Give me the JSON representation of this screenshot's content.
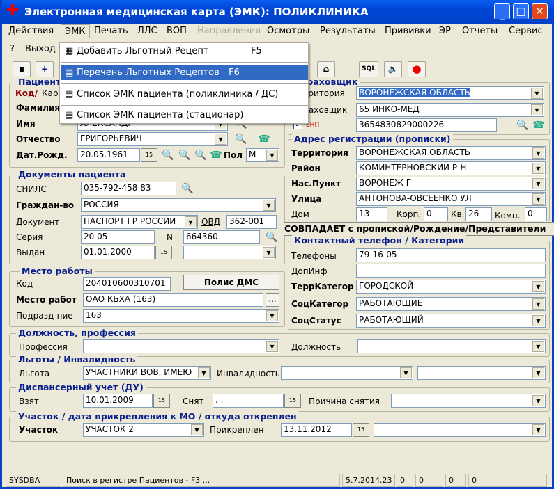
{
  "window": {
    "title": "Электронная медицинская карта (ЭМК): ПОЛИКЛИНИКА"
  },
  "menubar": [
    "Действия",
    "ЭМК",
    "Печать",
    "ЛЛС",
    "ВОП",
    "Направления",
    "Осмотры",
    "Результаты",
    "Прививки",
    "ЭР",
    "Отчеты",
    "Сервис"
  ],
  "menubar2": [
    "?",
    "Выход"
  ],
  "emk_menu": [
    {
      "label": "Добавить Льготный Рецепт",
      "shortcut": "F5"
    },
    {
      "label": "Перечень Льготных Рецептов",
      "shortcut": "F6",
      "highlighted": true
    },
    {
      "label": "Список ЭМК пациента (поликлиника / ДС)",
      "shortcut": ""
    },
    {
      "label": "Список ЭМК пациента (стационар)",
      "shortcut": ""
    }
  ],
  "toolbar": {
    "sql": "SQL"
  },
  "patient": {
    "header": "Пациент",
    "kod_label": "Код/",
    "kar_label": "Кар",
    "surname_label": "Фамилия",
    "name_label": "Имя",
    "name": "АЛЕКСАНДР",
    "patronymic_label": "Отчество",
    "patronymic": "ГРИГОРЬЕВИЧ",
    "dob_label": "Дат.Рожд.",
    "dob": "20.05.1961",
    "sex_label": "Пол",
    "sex": "М"
  },
  "documents": {
    "header": "Документы пациента",
    "snils_label": "СНИЛС",
    "snils": "035-792-458 83",
    "citizenship_label": "Граждан-во",
    "citizenship": "РОССИЯ",
    "doc_label": "Документ",
    "doc": "ПАСПОРТ ГР РОССИИ",
    "ovd_label": "ОВД",
    "ovd": "362-001",
    "series_label": "Серия",
    "series": "20 05",
    "n_label": "N",
    "number": "664360",
    "issued_label": "Выдан",
    "issued": "01.01.2000"
  },
  "work": {
    "header": "Место работы",
    "code_label": "Код",
    "code": "204010600310701",
    "dms_button": "Полис ДМС",
    "place_label": "Место работ",
    "place": "ОАО КБХА (163)",
    "more": "...",
    "dept_label": "Подразд-ние",
    "dept": "163"
  },
  "insurer": {
    "header": "Страховщик",
    "territory_label": "Территория",
    "territory": "ВОРОНЕЖСКАЯ ОБЛАСТЬ",
    "insurer_label": "Страховщик",
    "insurer": "65 ИНКО-МЕД",
    "enp_label": "ЕНП",
    "enp": "3654830829000226",
    "enp_checked": true
  },
  "address": {
    "header": "Адрес регистрации (прописки)",
    "territory_label": "Территория",
    "territory": "ВОРОНЕЖСКАЯ ОБЛАСТЬ",
    "district_label": "Район",
    "district": "КОМИНТЕРНОВСКИЙ Р-Н",
    "city_label": "Нас.Пункт",
    "city": "ВОРОНЕЖ Г",
    "street_label": "Улица",
    "street": "АНТОНОВА-ОВСЕЕНКО УЛ",
    "house_label": "Дом",
    "house": "13",
    "korp_label": "Корп.",
    "korp": "0",
    "kv_label": "Кв.",
    "kv": "26",
    "komn_label": "Комн.",
    "komn": "0"
  },
  "banner": "СОВПАДАЕТ с пропиской/Рождение/Представители",
  "contact": {
    "header": "Контактный телефон  / Категории",
    "phones_label": "Телефоны",
    "phones": "79-16-05",
    "dopinf_label": "ДопИнф",
    "terr_label": "ТеррКатегор",
    "terr": "ГОРОДСКОЙ",
    "soc_label": "СоцКатегор",
    "soc": "РАБОТАЮЩИЕ",
    "status_label": "СоцСтатус",
    "status": "РАБОТАЮЩИЙ"
  },
  "profession": {
    "header": "Должность, профессия",
    "profession_label": "Профессия",
    "position_label": "Должность"
  },
  "benefits": {
    "header": "Льготы / Инвалидность",
    "benefit_label": "Льгота",
    "benefit": "УЧАСТНИКИ ВОВ, ИМЕЮ",
    "disability_label": "Инвалидность"
  },
  "dispensary": {
    "header": "Диспансерный учет (ДУ)",
    "taken_label": "Взят",
    "taken": "10.01.2009",
    "removed_label": "Снят",
    "removed": " .  .",
    "reason_label": "Причина снятия"
  },
  "district": {
    "header": "Участок / дата прикрепления к МО / откуда откреплен",
    "label": "Участок",
    "value": "УЧАСТОК 2",
    "attached_label": "Прикреплен",
    "attached": "13.11.2012"
  },
  "statusbar": {
    "user": "SYSDBA",
    "hint": "Поиск в регистре Пациентов - F3 ...",
    "version": "5.7.2014.23",
    "c1": "0",
    "c2": "0",
    "c3": "0",
    "c4": "0"
  },
  "colors": {
    "title": "#0046d6",
    "highlight": "#316ac5",
    "header_text": "#0a1f8f"
  }
}
